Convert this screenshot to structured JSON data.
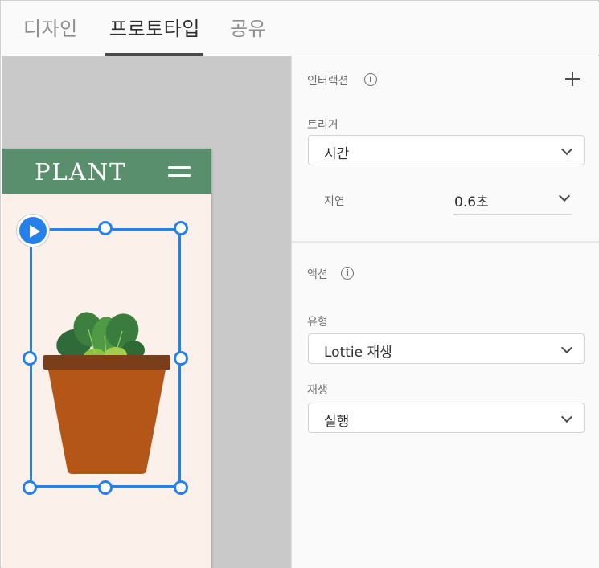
{
  "tabs": [
    {
      "label": "디자인",
      "active": false
    },
    {
      "label": "프로토타입",
      "active": true
    },
    {
      "label": "공유",
      "active": false
    }
  ],
  "artboard": {
    "brand": "PLANT",
    "header_color": "#5a8f6e",
    "background": "#fbf1ea"
  },
  "selection": {
    "color": "#2680eb"
  },
  "interaction": {
    "title": "인터랙션",
    "trigger_label": "트리거",
    "trigger_value": "시간",
    "delay_label": "지연",
    "delay_value": "0.6초"
  },
  "action": {
    "title": "액션",
    "type_label": "유형",
    "type_value": "Lottie 재생",
    "playback_label": "재생",
    "playback_value": "실행"
  },
  "icons": {
    "info": "info-icon",
    "add": "plus-icon",
    "dropdown": "chevron-down-icon",
    "play": "play-icon",
    "menu": "hamburger-menu-icon"
  }
}
